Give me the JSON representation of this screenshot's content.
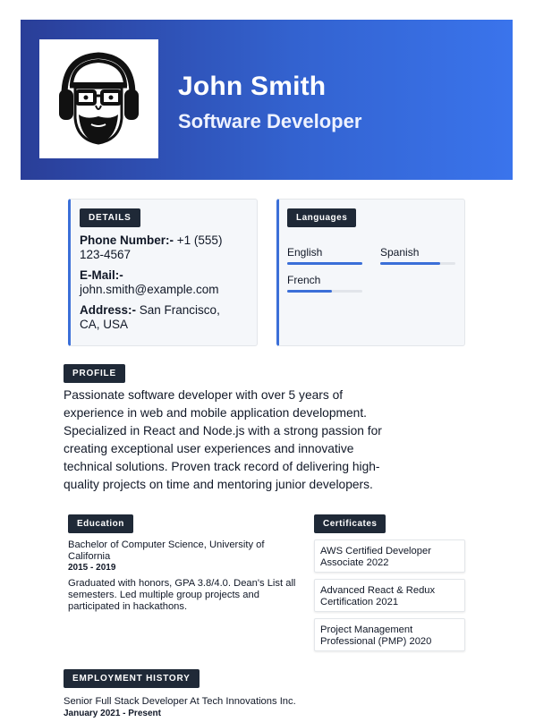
{
  "header": {
    "name": "John Smith",
    "title": "Software Developer",
    "gradient_start": "#2a3e98",
    "gradient_end": "#3a74ec"
  },
  "details": {
    "label": "DETAILS",
    "phone_label": "Phone Number:-",
    "phone_value": "+1 (555) 123-4567",
    "email_label": "E-Mail:-",
    "email_value": "john.smith@example.com",
    "address_label": "Address:-",
    "address_value": "San Francisco, CA, USA"
  },
  "languages": {
    "label": "Languages",
    "items": [
      {
        "name": "English",
        "level": 1.0
      },
      {
        "name": "Spanish",
        "level": 0.8
      },
      {
        "name": "French",
        "level": 0.6
      }
    ]
  },
  "profile": {
    "label": "PROFILE",
    "text": "Passionate software developer with over 5 years of experience in web and mobile application development. Specialized in React and Node.js with a strong passion for creating exceptional user experiences and innovative technical solutions. Proven track record of delivering high-quality projects on time and mentoring junior developers."
  },
  "education": {
    "label": "Education",
    "degree": "Bachelor of Computer Science, University of California",
    "dates": "2015 - 2019",
    "description": "Graduated with honors, GPA 3.8/4.0. Dean's List all semesters. Led multiple group projects and participated in hackathons."
  },
  "certificates": {
    "label": "Certificates",
    "items": [
      "AWS Certified Developer Associate 2022",
      "Advanced React & Redux Certification 2021",
      "Project Management Professional (PMP) 2020"
    ]
  },
  "employment": {
    "label": "EMPLOYMENT HISTORY",
    "job_title": "Senior Full Stack Developer At Tech Innovations Inc.",
    "dates": "January 2021 - Present"
  },
  "icons": {
    "avatar": "avatar-icon"
  },
  "colors": {
    "accent": "#3b6fd8",
    "badge_bg": "#1f2937"
  }
}
